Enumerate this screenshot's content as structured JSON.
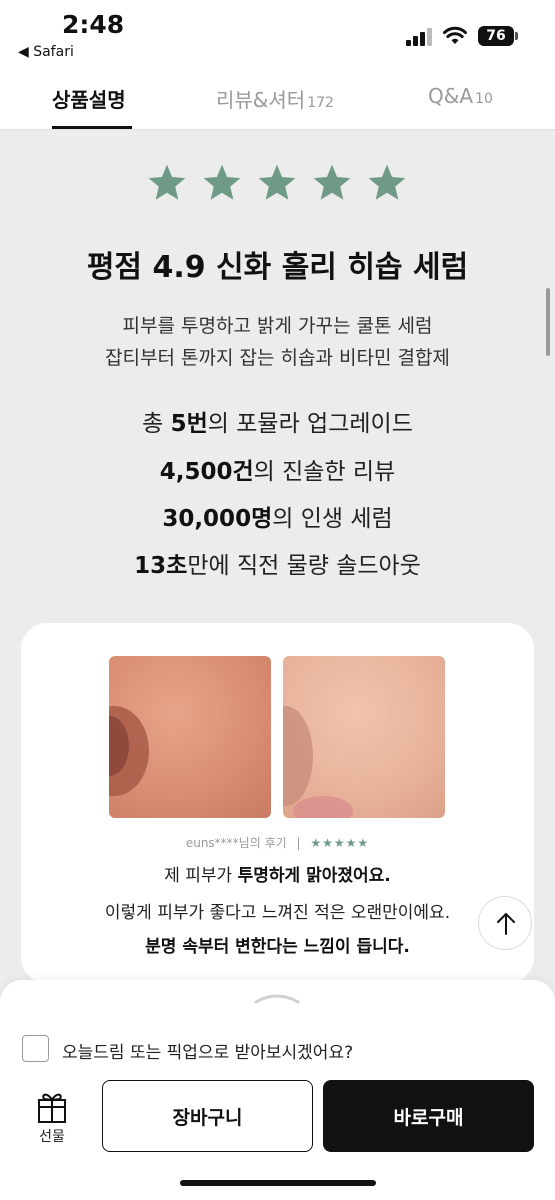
{
  "status_bar": {
    "time": "2:48",
    "back_label": "◀ Safari",
    "battery": "76"
  },
  "tabs": [
    {
      "label": "상품설명",
      "count": "",
      "active": true
    },
    {
      "label": "리뷰&셔터",
      "count": "172",
      "active": false
    },
    {
      "label": "Q&A",
      "count": "10",
      "active": false
    }
  ],
  "product": {
    "rating_stars": 5,
    "star_color": "#6f9a86",
    "headline": "평점 4.9 신화 홀리 히솝 세럼",
    "sublines": [
      "피부를 투명하고 밝게 가꾸는 쿨톤 세럼",
      "잡티부터 톤까지 잡는 히솝과 비타민 결합제"
    ],
    "stats": [
      {
        "prefix": "총 ",
        "bold": "5번",
        "suffix": "의 포뮬라 업그레이드"
      },
      {
        "prefix": "",
        "bold": "4,500건",
        "suffix": "의 진솔한 리뷰"
      },
      {
        "prefix": "",
        "bold": "30,000명",
        "suffix": "의 인생 세럼"
      },
      {
        "prefix": "",
        "bold": "13초",
        "suffix": "만에 직전 물량 솔드아웃"
      }
    ]
  },
  "review": {
    "reviewer": "euns****님의 후기",
    "separator": "|",
    "stars": "★★★★★",
    "line1_prefix": "제 피부가 ",
    "line1_bold": "투명하게 맑아졌어요.",
    "line2": "이렇게 피부가 좋다고 느껴진 적은 오랜만이에요.",
    "line3": "분명 속부터 변한다는 느낌이 듭니다."
  },
  "bottom_sheet": {
    "checkbox_label": "오늘드림 또는 픽업으로 받아보시겠어요?",
    "checkbox_checked": false,
    "gift_label": "선물",
    "cart_button": "장바구니",
    "buy_button": "바로구매"
  },
  "icons": [
    "signal-icon",
    "wifi-icon",
    "battery-icon",
    "star-icon",
    "arrow-up-icon",
    "gift-icon",
    "chevron-up-icon"
  ]
}
